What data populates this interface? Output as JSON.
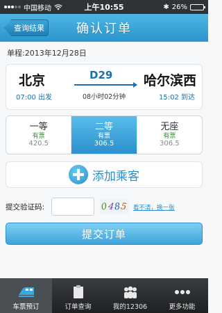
{
  "status_bar": {
    "carrier": "中国移动",
    "time": "上午10:55",
    "battery": "26%",
    "battery_level": 0.26
  },
  "nav": {
    "back_label": "查询结果",
    "title": "确认订单"
  },
  "trip": {
    "date_label": "单程:2013年12月28日",
    "from_city": "北京",
    "to_city": "哈尔滨西",
    "train_no": "D29",
    "depart_time": "07:00 出发",
    "arrive_time": "15:02 到达",
    "duration": "08小时02分钟"
  },
  "seats": [
    {
      "name": "一等",
      "avail": "有票",
      "price": "420.5",
      "selected": false
    },
    {
      "name": "二等",
      "avail": "有票",
      "price": "306.5",
      "selected": true
    },
    {
      "name": "无座",
      "avail": "有票",
      "price": "306.5",
      "selected": false
    }
  ],
  "add_passenger": {
    "label": "添加乘客"
  },
  "captcha": {
    "label": "提交验证码:",
    "input_value": "",
    "image_chars": [
      "0",
      "4",
      "8",
      "5"
    ],
    "refresh_label": "看不清，换一张"
  },
  "submit": {
    "label": "提交订单"
  },
  "tabs": [
    {
      "label": "车票预订",
      "icon": "train-icon",
      "active": true
    },
    {
      "label": "订单查询",
      "icon": "clipboard-icon",
      "active": false
    },
    {
      "label": "我的12306",
      "icon": "people-icon",
      "active": false
    },
    {
      "label": "更多功能",
      "icon": "more-icon",
      "active": false
    }
  ],
  "colors": {
    "accent": "#2a8fcd",
    "nav_bg": "#3aa6d8",
    "available_green": "#3a8e3a"
  }
}
